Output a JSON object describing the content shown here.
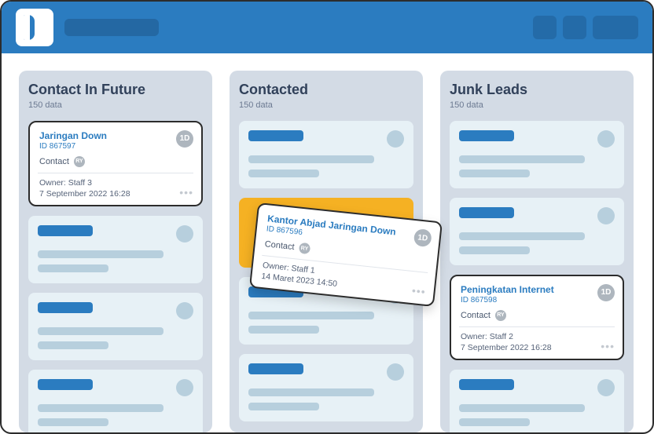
{
  "columns": [
    {
      "title": "Contact In Future",
      "subtitle": "150 data"
    },
    {
      "title": "Contacted",
      "subtitle": "150 data"
    },
    {
      "title": "Junk Leads",
      "subtitle": "150 data"
    }
  ],
  "cards": {
    "future": {
      "title": "Jaringan Down",
      "id": "ID 867597",
      "contact_label": "Contact",
      "avatar_initials": "RY",
      "badge": "1D",
      "owner": "Owner: Staff 3",
      "date": "7 September 2022 16:28"
    },
    "dragging": {
      "title": "Kantor Abjad Jaringan Down",
      "id": "ID 867596",
      "contact_label": "Contact",
      "avatar_initials": "RY",
      "badge": "1D",
      "owner": "Owner: Staff 1",
      "date": "14 Maret 2023 14:50"
    },
    "junk": {
      "title": "Peningkatan Internet",
      "id": "ID 867598",
      "contact_label": "Contact",
      "avatar_initials": "RY",
      "badge": "1D",
      "owner": "Owner: Staff 2",
      "date": "7 September 2022 16:28"
    }
  }
}
